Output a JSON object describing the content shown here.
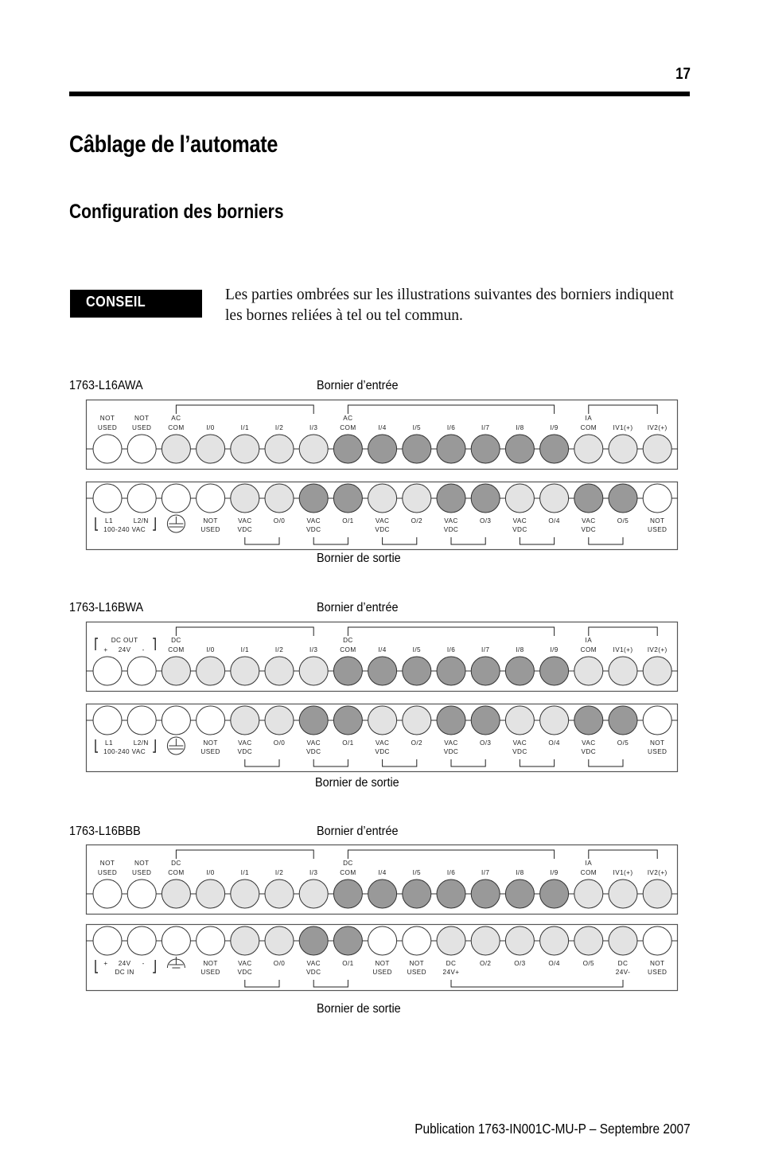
{
  "header": {
    "page_number": "17"
  },
  "page_title": "Câblage de l’automate",
  "section_title": "Configuration des borniers",
  "tip": {
    "badge": "CONSEIL",
    "text": "Les parties ombrées sur les illustrations suivantes des borniers indiquent les bornes reliées à tel ou tel commun."
  },
  "shade_colors": {
    "none": "#ffffff",
    "light": "#e3e3e3",
    "dark": "#999999"
  },
  "diagrams": [
    {
      "model": "1763-L16AWA",
      "input_label": "Bornier d’entrée",
      "output_label": "Bornier de sortie",
      "input_terminals": [
        {
          "label": [
            "NOT",
            "USED"
          ],
          "shade": "none"
        },
        {
          "label": [
            "NOT",
            "USED"
          ],
          "shade": "none"
        },
        {
          "label": [
            "AC",
            "COM"
          ],
          "shade": "light"
        },
        {
          "label": [
            "I/0"
          ],
          "shade": "light"
        },
        {
          "label": [
            "I/1"
          ],
          "shade": "light"
        },
        {
          "label": [
            "I/2"
          ],
          "shade": "light"
        },
        {
          "label": [
            "I/3"
          ],
          "shade": "light"
        },
        {
          "label": [
            "AC",
            "COM"
          ],
          "shade": "dark"
        },
        {
          "label": [
            "I/4"
          ],
          "shade": "dark"
        },
        {
          "label": [
            "I/5"
          ],
          "shade": "dark"
        },
        {
          "label": [
            "I/6"
          ],
          "shade": "dark"
        },
        {
          "label": [
            "I/7"
          ],
          "shade": "dark"
        },
        {
          "label": [
            "I/8"
          ],
          "shade": "dark"
        },
        {
          "label": [
            "I/9"
          ],
          "shade": "dark"
        },
        {
          "label": [
            "IA",
            "COM"
          ],
          "shade": "light"
        },
        {
          "label": [
            "IV1(+)"
          ],
          "shade": "light"
        },
        {
          "label": [
            "IV2(+)"
          ],
          "shade": "light"
        }
      ],
      "input_left_group": null,
      "input_brackets": [
        [
          2,
          6
        ],
        [
          7,
          13
        ],
        [
          14,
          16
        ]
      ],
      "output_left_group": {
        "line1": [
          "L1",
          "L2/N"
        ],
        "line2": "100-240 VAC"
      },
      "output_terminals": [
        {
          "label": [],
          "shade": "none"
        },
        {
          "label": [],
          "shade": "none"
        },
        {
          "label": [
            "GROUND"
          ],
          "shade": "none",
          "ground": "protective"
        },
        {
          "label": [
            "NOT",
            "USED"
          ],
          "shade": "none"
        },
        {
          "label": [
            "VAC",
            "VDC"
          ],
          "shade": "light"
        },
        {
          "label": [
            "O/0"
          ],
          "shade": "light"
        },
        {
          "label": [
            "VAC",
            "VDC"
          ],
          "shade": "dark"
        },
        {
          "label": [
            "O/1"
          ],
          "shade": "dark"
        },
        {
          "label": [
            "VAC",
            "VDC"
          ],
          "shade": "light"
        },
        {
          "label": [
            "O/2"
          ],
          "shade": "light"
        },
        {
          "label": [
            "VAC",
            "VDC"
          ],
          "shade": "dark"
        },
        {
          "label": [
            "O/3"
          ],
          "shade": "dark"
        },
        {
          "label": [
            "VAC",
            "VDC"
          ],
          "shade": "light"
        },
        {
          "label": [
            "O/4"
          ],
          "shade": "light"
        },
        {
          "label": [
            "VAC",
            "VDC"
          ],
          "shade": "dark"
        },
        {
          "label": [
            "O/5"
          ],
          "shade": "dark"
        },
        {
          "label": [
            "NOT",
            "USED"
          ],
          "shade": "none"
        }
      ],
      "output_brackets": [
        [
          4,
          5
        ],
        [
          6,
          7
        ],
        [
          8,
          9
        ],
        [
          10,
          11
        ],
        [
          12,
          13
        ],
        [
          14,
          15
        ]
      ]
    },
    {
      "model": "1763-L16BWA",
      "input_label": "Bornier d’entrée",
      "output_label": "Bornier de sortie",
      "input_left_group": {
        "line1": "DC OUT",
        "line2": [
          "+",
          "24V",
          "-"
        ]
      },
      "input_terminals": [
        {
          "label": [],
          "shade": "none"
        },
        {
          "label": [],
          "shade": "none"
        },
        {
          "label": [
            "DC",
            "COM"
          ],
          "shade": "light"
        },
        {
          "label": [
            "I/0"
          ],
          "shade": "light"
        },
        {
          "label": [
            "I/1"
          ],
          "shade": "light"
        },
        {
          "label": [
            "I/2"
          ],
          "shade": "light"
        },
        {
          "label": [
            "I/3"
          ],
          "shade": "light"
        },
        {
          "label": [
            "DC",
            "COM"
          ],
          "shade": "dark"
        },
        {
          "label": [
            "I/4"
          ],
          "shade": "dark"
        },
        {
          "label": [
            "I/5"
          ],
          "shade": "dark"
        },
        {
          "label": [
            "I/6"
          ],
          "shade": "dark"
        },
        {
          "label": [
            "I/7"
          ],
          "shade": "dark"
        },
        {
          "label": [
            "I/8"
          ],
          "shade": "dark"
        },
        {
          "label": [
            "I/9"
          ],
          "shade": "dark"
        },
        {
          "label": [
            "IA",
            "COM"
          ],
          "shade": "light"
        },
        {
          "label": [
            "IV1(+)"
          ],
          "shade": "light"
        },
        {
          "label": [
            "IV2(+)"
          ],
          "shade": "light"
        }
      ],
      "input_brackets": [
        [
          2,
          6
        ],
        [
          7,
          13
        ],
        [
          14,
          16
        ]
      ],
      "output_left_group": {
        "line1": [
          "L1",
          "L2/N"
        ],
        "line2": "100-240 VAC"
      },
      "output_terminals": [
        {
          "label": [],
          "shade": "none"
        },
        {
          "label": [],
          "shade": "none"
        },
        {
          "label": [
            "GROUND"
          ],
          "shade": "none",
          "ground": "protective"
        },
        {
          "label": [
            "NOT",
            "USED"
          ],
          "shade": "none"
        },
        {
          "label": [
            "VAC",
            "VDC"
          ],
          "shade": "light"
        },
        {
          "label": [
            "O/0"
          ],
          "shade": "light"
        },
        {
          "label": [
            "VAC",
            "VDC"
          ],
          "shade": "dark"
        },
        {
          "label": [
            "O/1"
          ],
          "shade": "dark"
        },
        {
          "label": [
            "VAC",
            "VDC"
          ],
          "shade": "light"
        },
        {
          "label": [
            "O/2"
          ],
          "shade": "light"
        },
        {
          "label": [
            "VAC",
            "VDC"
          ],
          "shade": "dark"
        },
        {
          "label": [
            "O/3"
          ],
          "shade": "dark"
        },
        {
          "label": [
            "VAC",
            "VDC"
          ],
          "shade": "light"
        },
        {
          "label": [
            "O/4"
          ],
          "shade": "light"
        },
        {
          "label": [
            "VAC",
            "VDC"
          ],
          "shade": "dark"
        },
        {
          "label": [
            "O/5"
          ],
          "shade": "dark"
        },
        {
          "label": [
            "NOT",
            "USED"
          ],
          "shade": "none"
        }
      ],
      "output_brackets": [
        [
          4,
          5
        ],
        [
          6,
          7
        ],
        [
          8,
          9
        ],
        [
          10,
          11
        ],
        [
          12,
          13
        ],
        [
          14,
          15
        ]
      ]
    },
    {
      "model": "1763-L16BBB",
      "input_label": "Bornier d’entrée",
      "output_label": "Bornier de sortie",
      "input_left_group": null,
      "input_terminals": [
        {
          "label": [
            "NOT",
            "USED"
          ],
          "shade": "none"
        },
        {
          "label": [
            "NOT",
            "USED"
          ],
          "shade": "none"
        },
        {
          "label": [
            "DC",
            "COM"
          ],
          "shade": "light"
        },
        {
          "label": [
            "I/0"
          ],
          "shade": "light"
        },
        {
          "label": [
            "I/1"
          ],
          "shade": "light"
        },
        {
          "label": [
            "I/2"
          ],
          "shade": "light"
        },
        {
          "label": [
            "I/3"
          ],
          "shade": "light"
        },
        {
          "label": [
            "DC",
            "COM"
          ],
          "shade": "dark"
        },
        {
          "label": [
            "I/4"
          ],
          "shade": "dark"
        },
        {
          "label": [
            "I/5"
          ],
          "shade": "dark"
        },
        {
          "label": [
            "I/6"
          ],
          "shade": "dark"
        },
        {
          "label": [
            "I/7"
          ],
          "shade": "dark"
        },
        {
          "label": [
            "I/8"
          ],
          "shade": "dark"
        },
        {
          "label": [
            "I/9"
          ],
          "shade": "dark"
        },
        {
          "label": [
            "IA",
            "COM"
          ],
          "shade": "light"
        },
        {
          "label": [
            "IV1(+)"
          ],
          "shade": "light"
        },
        {
          "label": [
            "IV2(+)"
          ],
          "shade": "light"
        }
      ],
      "input_brackets": [
        [
          2,
          6
        ],
        [
          7,
          13
        ],
        [
          14,
          16
        ]
      ],
      "output_left_group": {
        "line1": [
          "+",
          "24V",
          "-"
        ],
        "line2": "DC IN"
      },
      "output_terminals": [
        {
          "label": [],
          "shade": "none"
        },
        {
          "label": [],
          "shade": "none"
        },
        {
          "label": [
            "GROUND"
          ],
          "shade": "none",
          "ground": "chassis"
        },
        {
          "label": [
            "NOT",
            "USED"
          ],
          "shade": "none"
        },
        {
          "label": [
            "VAC",
            "VDC"
          ],
          "shade": "light"
        },
        {
          "label": [
            "O/0"
          ],
          "shade": "light"
        },
        {
          "label": [
            "VAC",
            "VDC"
          ],
          "shade": "dark"
        },
        {
          "label": [
            "O/1"
          ],
          "shade": "dark"
        },
        {
          "label": [
            "NOT",
            "USED"
          ],
          "shade": "none"
        },
        {
          "label": [
            "NOT",
            "USED"
          ],
          "shade": "none"
        },
        {
          "label": [
            "DC",
            "24V+"
          ],
          "shade": "light"
        },
        {
          "label": [
            "O/2"
          ],
          "shade": "light"
        },
        {
          "label": [
            "O/3"
          ],
          "shade": "light"
        },
        {
          "label": [
            "O/4"
          ],
          "shade": "light"
        },
        {
          "label": [
            "O/5"
          ],
          "shade": "light"
        },
        {
          "label": [
            "DC",
            "24V-"
          ],
          "shade": "light"
        },
        {
          "label": [
            "NOT",
            "USED"
          ],
          "shade": "none"
        }
      ],
      "output_brackets": [
        [
          4,
          5
        ],
        [
          6,
          7
        ],
        [
          10,
          15
        ]
      ]
    }
  ],
  "footer": {
    "publication": "Publication 1763-IN001C-MU-P – Septembre 2007"
  }
}
